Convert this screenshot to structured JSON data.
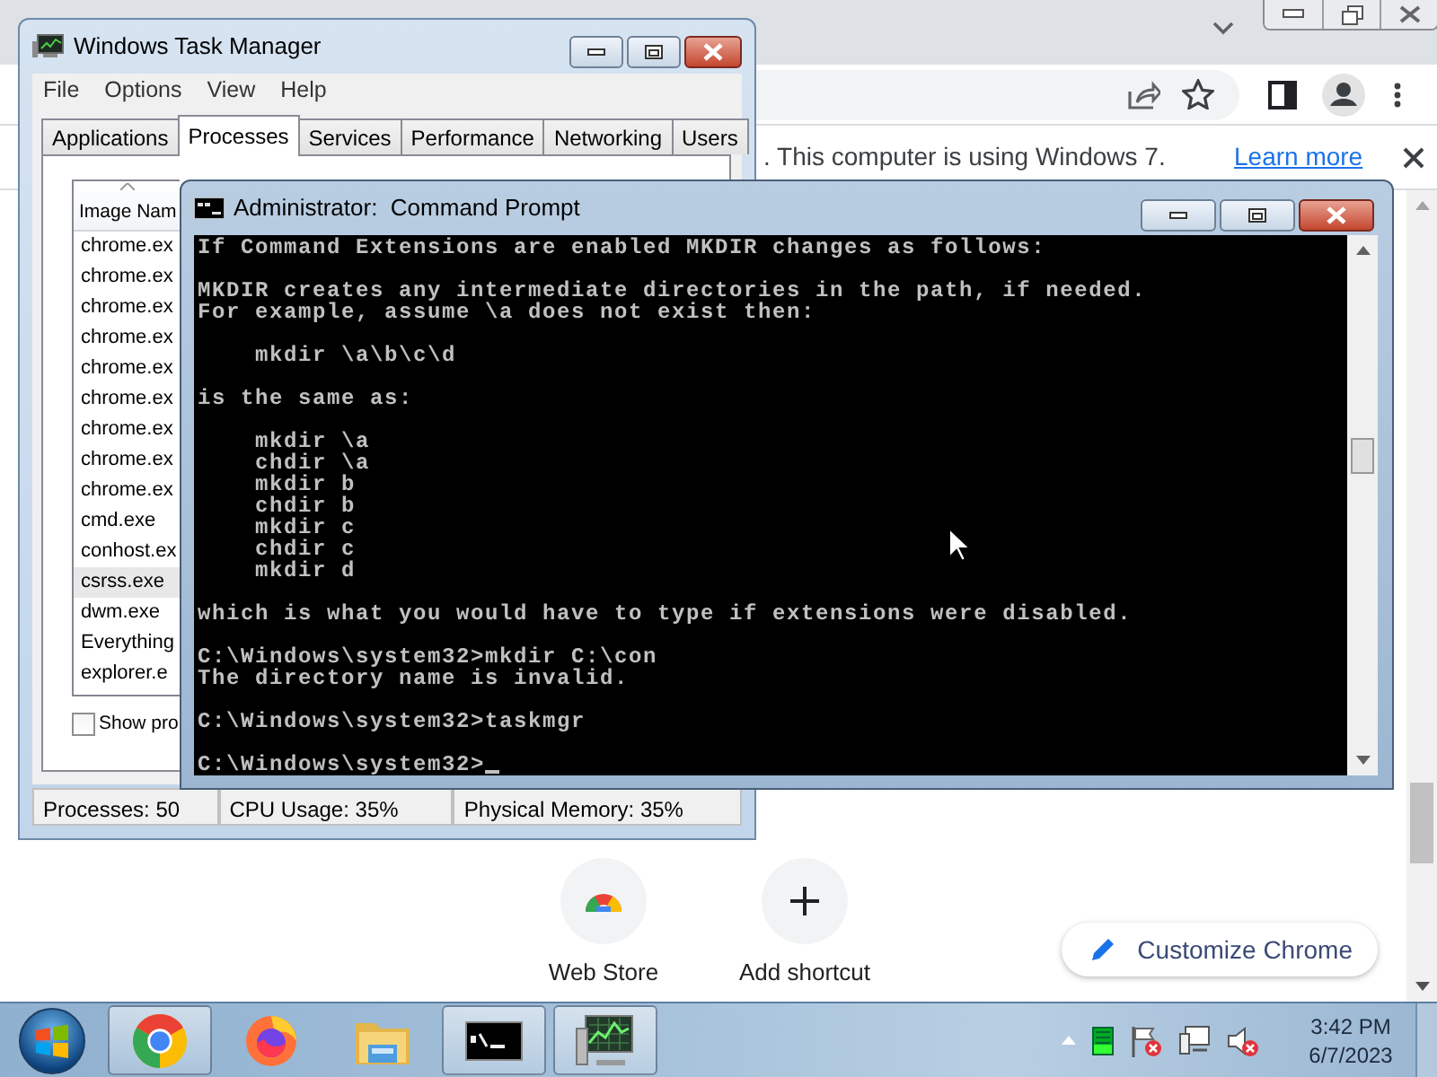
{
  "browser": {
    "infobar": {
      "message": ". This computer is using Windows 7.",
      "link": "Learn more"
    },
    "shortcuts": [
      {
        "kind": "webstore",
        "label": "Web Store"
      },
      {
        "kind": "add",
        "label": "Add shortcut"
      }
    ],
    "customize_button": "Customize Chrome"
  },
  "task_manager": {
    "title": "Windows Task Manager",
    "menu": [
      "File",
      "Options",
      "View",
      "Help"
    ],
    "tabs": [
      {
        "label": "Applications",
        "selected": false
      },
      {
        "label": "Processes",
        "selected": true
      },
      {
        "label": "Services",
        "selected": false
      },
      {
        "label": "Performance",
        "selected": false
      },
      {
        "label": "Networking",
        "selected": false
      },
      {
        "label": "Users",
        "selected": false
      }
    ],
    "column": "Image Nam",
    "processes": [
      {
        "name": "chrome.ex",
        "selected": false
      },
      {
        "name": "chrome.ex",
        "selected": false
      },
      {
        "name": "chrome.ex",
        "selected": false
      },
      {
        "name": "chrome.ex",
        "selected": false
      },
      {
        "name": "chrome.ex",
        "selected": false
      },
      {
        "name": "chrome.ex",
        "selected": false
      },
      {
        "name": "chrome.ex",
        "selected": false
      },
      {
        "name": "chrome.ex",
        "selected": false
      },
      {
        "name": "chrome.ex",
        "selected": false
      },
      {
        "name": "cmd.exe",
        "selected": false
      },
      {
        "name": "conhost.ex",
        "selected": false
      },
      {
        "name": "csrss.exe",
        "selected": true
      },
      {
        "name": "dwm.exe",
        "selected": false
      },
      {
        "name": "Everything",
        "selected": false
      },
      {
        "name": "explorer.e",
        "selected": false
      }
    ],
    "show_all": {
      "label": "Show pro",
      "checked": false
    },
    "status_bar": [
      "Processes: 50",
      "CPU Usage: 35%",
      "Physical Memory: 35%"
    ]
  },
  "command_prompt": {
    "title": "Administrator:  Command Prompt",
    "blocks": [
      [
        "If Command Extensions are enabled MKDIR changes as follows:"
      ],
      [
        "MKDIR creates any intermediate directories in the path, if needed.",
        "For example, assume \\a does not exist then:"
      ],
      [
        "    mkdir \\a\\b\\c\\d"
      ],
      [
        "is the same as:"
      ],
      [
        "    mkdir \\a",
        "    chdir \\a",
        "    mkdir b",
        "    chdir b",
        "    mkdir c",
        "    chdir c",
        "    mkdir d"
      ],
      [
        "which is what you would have to type if extensions were disabled."
      ],
      [
        "C:\\Windows\\system32>mkdir C:\\con",
        "The directory name is invalid."
      ],
      [
        "C:\\Windows\\system32>taskmgr"
      ],
      [
        "C:\\Windows\\system32>"
      ]
    ],
    "cursor": true
  },
  "taskbar": {
    "items": [
      {
        "kind": "chrome",
        "running": true
      },
      {
        "kind": "firefox",
        "running": false
      },
      {
        "kind": "explorer",
        "running": false
      },
      {
        "kind": "cmd",
        "running": true
      },
      {
        "kind": "taskmgr",
        "running": true
      }
    ],
    "clock": {
      "time": "3:42 PM",
      "date": "6/7/2023"
    }
  }
}
